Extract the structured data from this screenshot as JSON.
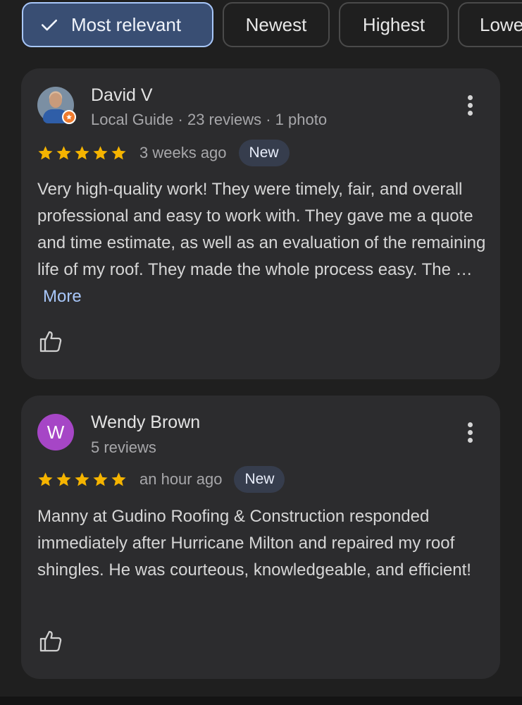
{
  "filters": {
    "chips": [
      {
        "label": "Most relevant",
        "selected": true
      },
      {
        "label": "Newest",
        "selected": false
      },
      {
        "label": "Highest",
        "selected": false
      },
      {
        "label": "Lowe",
        "selected": false
      }
    ]
  },
  "reviews": [
    {
      "author": "David V",
      "meta": "Local Guide · 23 reviews · 1 photo",
      "rating": 5,
      "time": "3 weeks ago",
      "badge": "New",
      "text": "Very high-quality work! They were timely, fair, and overall professional and easy to work with. They gave me a quote and time estimate, as well as an evaluation of the remaining life of my roof. They made the whole process easy. The …",
      "more_label": "More",
      "avatar_icon": "profile-photo-icon",
      "menu_icon": "more-vert-icon",
      "like_icon": "thumbs-up-icon"
    },
    {
      "author": "Wendy Brown",
      "meta": "5 reviews",
      "rating": 5,
      "time": "an hour ago",
      "badge": "New",
      "text": "Manny at Gudino Roofing & Construction responded immediately after Hurricane Milton and repaired my roof shingles. He was courteous, knowledgeable, and efficient!",
      "avatar_letter": "W",
      "avatar_color": "#a646c6",
      "menu_icon": "more-vert-icon",
      "like_icon": "thumbs-up-icon"
    }
  ],
  "colors": {
    "background": "#1f1f1f",
    "card": "#2c2c2e",
    "accent": "#a8c7fa",
    "selected_chip": "#394e73",
    "star": "#f5b400"
  }
}
